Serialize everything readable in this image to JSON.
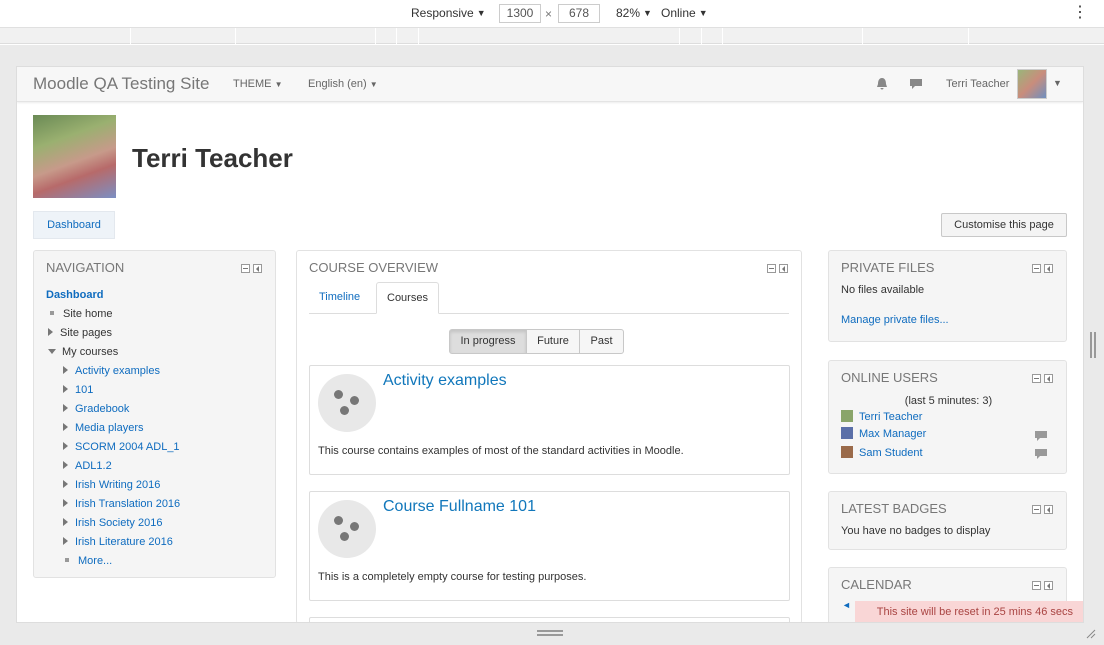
{
  "devtools": {
    "device_mode": "Responsive",
    "width": "1300",
    "times": "×",
    "height": "678",
    "zoom": "82%",
    "network": "Online"
  },
  "navbar": {
    "brand": "Moodle QA Testing Site",
    "theme_menu": "THEME",
    "language_menu": "English (en)",
    "user_name": "Terri Teacher"
  },
  "header": {
    "title": "Terri Teacher",
    "breadcrumb": "Dashboard",
    "customise_button": "Customise this page"
  },
  "navigation": {
    "title": "NAVIGATION",
    "root": "Dashboard",
    "items": [
      {
        "label": "Site home",
        "marker": "square",
        "indent": 1
      },
      {
        "label": "Site pages",
        "marker": "arrow-right",
        "indent": 1
      },
      {
        "label": "My courses",
        "marker": "arrow-down",
        "indent": 1
      },
      {
        "label": "Activity examples",
        "marker": "arrow-right",
        "indent": 2
      },
      {
        "label": "101",
        "marker": "arrow-right",
        "indent": 2
      },
      {
        "label": "Gradebook",
        "marker": "arrow-right",
        "indent": 2
      },
      {
        "label": "Media players",
        "marker": "arrow-right",
        "indent": 2
      },
      {
        "label": "SCORM 2004 ADL_1",
        "marker": "arrow-right",
        "indent": 2
      },
      {
        "label": "ADL1.2",
        "marker": "arrow-right",
        "indent": 2
      },
      {
        "label": "Irish Writing 2016",
        "marker": "arrow-right",
        "indent": 2
      },
      {
        "label": "Irish Translation 2016",
        "marker": "arrow-right",
        "indent": 2
      },
      {
        "label": "Irish Society 2016",
        "marker": "arrow-right",
        "indent": 2
      },
      {
        "label": "Irish Literature 2016",
        "marker": "arrow-right",
        "indent": 2
      },
      {
        "label": "More...",
        "marker": "square",
        "indent": 2
      }
    ]
  },
  "course_overview": {
    "title": "COURSE OVERVIEW",
    "tabs": [
      "Timeline",
      "Courses"
    ],
    "filters": [
      "In progress",
      "Future",
      "Past"
    ],
    "courses": [
      {
        "name": "Activity examples",
        "summary": "This course contains examples of most of the standard activities in Moodle."
      },
      {
        "name": "Course Fullname 101",
        "summary": "This is a completely empty course for testing purposes."
      }
    ]
  },
  "private_files": {
    "title": "PRIVATE FILES",
    "empty_text": "No files available",
    "manage_link": "Manage private files..."
  },
  "online_users": {
    "title": "ONLINE USERS",
    "subtitle": "(last 5 minutes: 3)",
    "users": [
      "Terri Teacher",
      "Max Manager",
      "Sam Student"
    ]
  },
  "latest_badges": {
    "title": "LATEST BADGES",
    "empty_text": "You have no badges to display"
  },
  "calendar": {
    "title": "CALENDAR",
    "prev_arrow": "◄"
  },
  "reset_notice": "This site will be reset in 25 mins 46 secs",
  "colors": {
    "link": "#0f6cbf",
    "notice_bg": "#f9d6d6",
    "notice_text": "#a94442"
  }
}
